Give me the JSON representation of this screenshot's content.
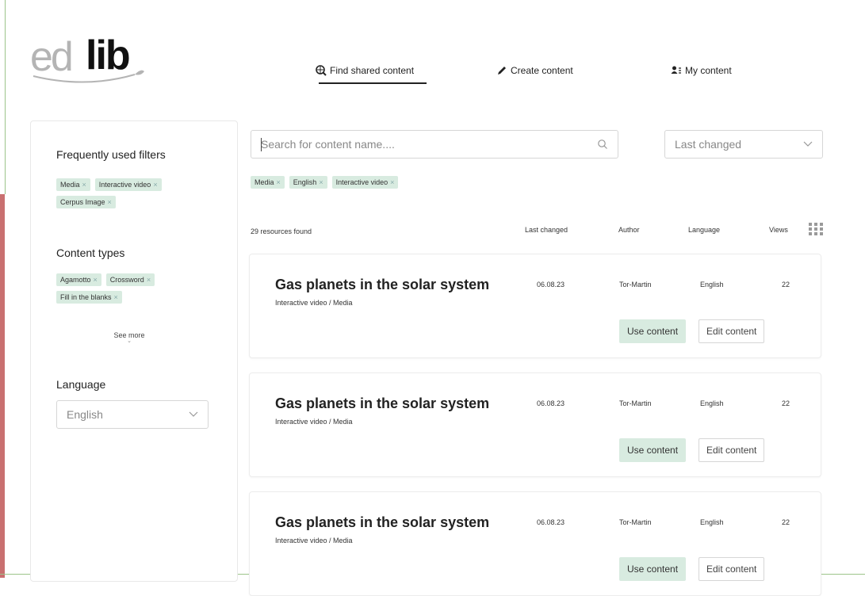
{
  "logo": {
    "part1": "ed",
    "part2": "lib"
  },
  "nav": {
    "items": [
      {
        "label": "Find shared content",
        "icon": "search-globe-icon",
        "active": true
      },
      {
        "label": "Create content",
        "icon": "pencil-icon",
        "active": false
      },
      {
        "label": "My content",
        "icon": "user-list-icon",
        "active": false
      }
    ]
  },
  "sidebar": {
    "frequent_heading": "Frequently used filters",
    "frequent_chips": [
      "Media",
      "Interactive video",
      "Cerpus Image"
    ],
    "content_types_heading": "Content types",
    "content_type_chips": [
      "Agamotto",
      "Crossword",
      "Fill in the blanks"
    ],
    "see_more": "See more",
    "language_heading": "Language",
    "language_value": "English"
  },
  "search": {
    "placeholder": "Search for content name...."
  },
  "sort": {
    "value": "Last changed"
  },
  "active_chips": [
    "Media",
    "English",
    "Interactive video"
  ],
  "results": {
    "count_label": "29 resources found",
    "columns": [
      "Last changed",
      "Author",
      "Language",
      "Views"
    ],
    "items": [
      {
        "title": "Gas planets in the solar system",
        "subtitle": "Interactive video / Media",
        "date": "06.08.23",
        "author": "Tor-Martin",
        "language": "English",
        "views": "22",
        "use_label": "Use content",
        "edit_label": "Edit content"
      },
      {
        "title": "Gas planets in the solar system",
        "subtitle": "Interactive video / Media",
        "date": "06.08.23",
        "author": "Tor-Martin",
        "language": "English",
        "views": "22",
        "use_label": "Use content",
        "edit_label": "Edit content"
      },
      {
        "title": "Gas planets in the solar system",
        "subtitle": "Interactive video / Media",
        "date": "06.08.23",
        "author": "Tor-Martin",
        "language": "English",
        "views": "22",
        "use_label": "Use content",
        "edit_label": "Edit content"
      }
    ]
  },
  "colors": {
    "chip_bg": "#d8ebe0",
    "accent_dark": "#222222",
    "edge_green": "#9cc48a",
    "edge_red": "#c97070"
  }
}
